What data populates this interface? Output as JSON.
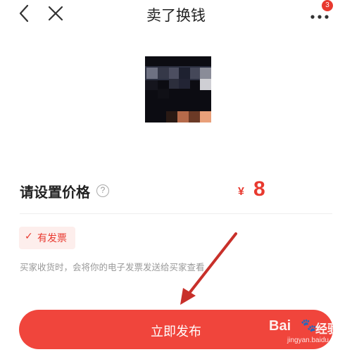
{
  "header": {
    "title": "卖了换钱",
    "more_badge_count": "3"
  },
  "product": {
    "image_icon": "pixelated-product-photo"
  },
  "price": {
    "label": "请设置价格",
    "help_glyph": "?",
    "currency": "¥",
    "value": "8"
  },
  "invoice": {
    "check_glyph": "✓",
    "tag_label": "有发票",
    "note": "买家收货时，会将你的电子发票发送给买家查看"
  },
  "footer": {
    "publish_label": "立即发布"
  },
  "watermark": {
    "brand": "Bai",
    "paw": "🐾",
    "cn": "经验",
    "domain": "jingyan.baidu.com"
  },
  "colors": {
    "accent": "#f0453c",
    "price": "#e8392f",
    "tag_bg": "#fdeeec",
    "annotation_arrow": "#c8302a"
  }
}
